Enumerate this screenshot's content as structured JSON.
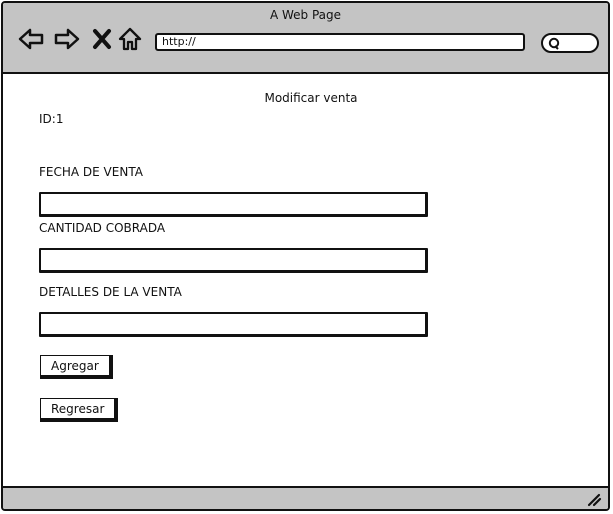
{
  "window": {
    "title": "A Web Page"
  },
  "toolbar": {
    "icons": [
      "back-arrow-icon",
      "forward-arrow-icon",
      "close-x-icon",
      "home-icon"
    ],
    "url": "http://",
    "search_icon": "search-icon"
  },
  "page": {
    "title": "Modificar venta",
    "id_label": "ID:1",
    "fields": [
      {
        "label": "FECHA DE VENTA",
        "value": ""
      },
      {
        "label": "CANTIDAD COBRADA",
        "value": ""
      },
      {
        "label": "DETALLES DE LA VENTA",
        "value": ""
      }
    ],
    "buttons": {
      "add": "Agregar",
      "back": "Regresar"
    }
  },
  "statusbar": {
    "icon": "resize-grip-icon"
  }
}
